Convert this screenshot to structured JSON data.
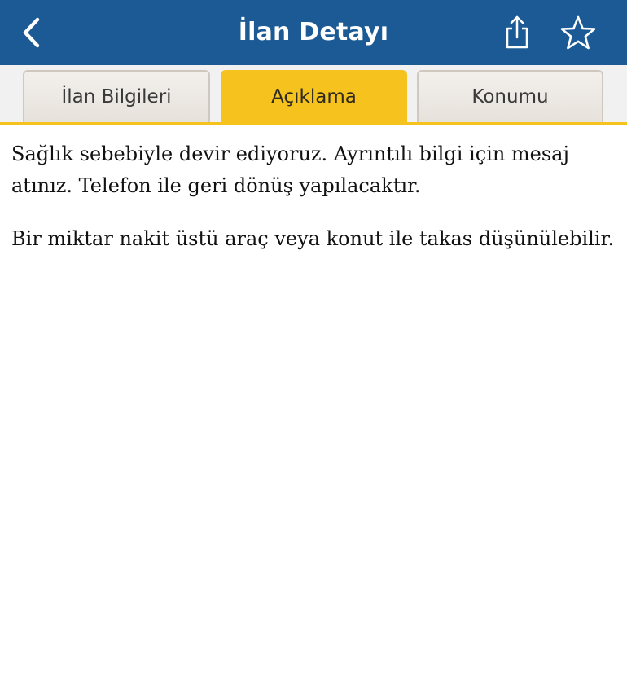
{
  "header": {
    "title": "İlan Detayı",
    "background_color": "#1b5a94",
    "icons": {
      "back": "chevron-left-icon",
      "share": "share-icon",
      "favorite": "star-outline-icon"
    }
  },
  "tabs": {
    "active_color": "#f6c21e",
    "items": [
      {
        "label": "İlan Bilgileri",
        "active": false
      },
      {
        "label": "Açıklama",
        "active": true
      },
      {
        "label": "Konumu",
        "active": false
      }
    ]
  },
  "description": {
    "paragraph_1": "Sağlık sebebiyle devir ediyoruz. Ayrıntılı bilgi için mesaj atınız. Telefon ile geri dönüş yapılacaktır.",
    "paragraph_2": "Bir miktar nakit üstü araç veya konut ile takas düşünülebilir."
  }
}
